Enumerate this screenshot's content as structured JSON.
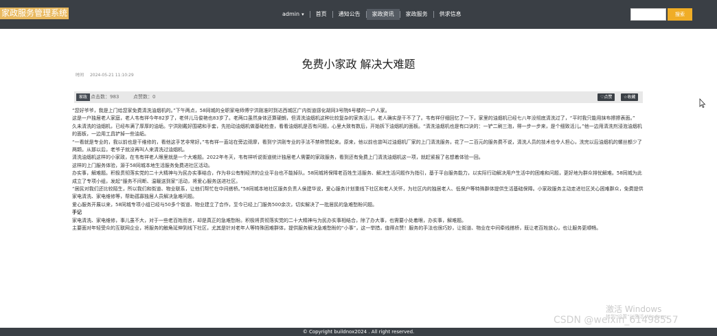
{
  "header": {
    "brand": "家政服务管理系统",
    "user_menu": "admin",
    "nav": [
      "首页",
      "通知公告",
      "家政资讯",
      "家政服务",
      "供求信息"
    ],
    "active_nav": "家政资讯",
    "search_placeholder": "",
    "search_label": "搜索"
  },
  "article": {
    "title": "免费小家政 解决大难题",
    "time_label": "时间",
    "time_value": "2024-05-21 11:10:29",
    "tag": "家政",
    "clicks": "点击数：983",
    "likes": "点赞数：0",
    "like_button": "♡点赞",
    "favorite_button": "☆收藏",
    "paragraphs": [
      "“您好爷爷，我是上门给您家免费清洗油烟机的。”下午两点，58同城的全职家电师傅宁洪刚准时到达西城区广内街道感化胡同3号院6号楼的一户人家。",
      "这是一户独居老人家庭，老人韦有祥今年82岁了，老伴儿马俊艳也83岁了。老两口虽然身体还算硬朗，但清洗油烟机这种比较复杂的家务活儿，老人确实是干不了了。韦有祥仔细回忆了一下，家里的油烟机已经七八年没彻底清洗过了，“平时我只能用抹布擦擦表面。”",
      "久未清洗的油烟机，已经布满了厚厚的油垢。宁洪刚戴好围裙和手套，先拍动油烟机做基础检查，看看油烟机是否有问题，心里大致有数后，开始拆下油烟机的面板。“清洗油烟机也是有口诀的：一铲二刷三泡，得一步一步来，是个细致活儿。”他一边用清洗剂浸泡油烟机的面板，一边用工具铲掉一些油垢。",
      "“一看就是专业的，我以前也是干维修的，看他这手艺非常好。”韦有祥一直站在旁边观摩，看到宁洪刚专业的手法不禁称赞起来。原来，他以前也曾叫过油烟机厂家的上门清洗服务，花了一二百元的服务费不说，清洗人员的技术也令人担心，洗完以后油烟机的螺丝都少了两颗。从那以后，老爷子就没再叫人来清洗过油烟机。",
      "清洗油烟机这样的小家政，在韦有祥老人眼里就是一个大难题。2022年冬天，韦有祥听说街道统计独居老人需要的家政服务，看到还有免费上门清洗油烟机这一项，就赶紧报了名想着体验一回。",
      "这样的上门服务体验，源于58同城本地生活服务免费进社区活动。",
      "办实事，解难题。积极贯彻落实党的二十大精神与为民办实事结合，作为非公有制经济的企业平台也不能掉队。58同城将保障老百姓生活服务、解决生活问题作为指引，基于平台服务能力，以实际行动解决用户生活中的困难和问题，更好地为群众排忧解难。58同城为此成立了专项小组，发起“服务不间断、温暖送到家”活动，将爱心服务送进社区。",
      "“居民对我们还比较陌生，所以我们和街道、物业联系，让他们帮忙在中间搭桥。”58同城本地社区服务负责人侯建华说，爱心服务计划重线下社区和老人关怀，为社区内的独居老人、低保户等特殊群体提供生活基础保障。小家政服务主动走进社区关心困难群众，免费提供家电清洗、家电维修等，帮助孤寡独居人员解决急难问题。",
      "爱心服务开展以来，58同城专项小组已经与50多个街道、物业建立了合作，至今已经上门服务500余次，切实解决了一批居民的急难愁盼问题。",
      "手记",
      "家电清洗、家电维修，事儿虽不大，对于一些老百姓而言，却是真正的急难愁盼。积极将贯彻落实党的二十大精神与为民办实事相结合，除了办大事，也需要小处着眼，办实事，解难题。",
      "主要面对年轻受众的互联网企业，将服务的触角延伸到线下社区，尤其是针对老年人等特殊困难群体，提供服务解决急难愁盼的“小事”，这一举措，值得点赞！服务的手法也很巧妙，让街道、物业在中间牵线搭桥，既让老百姓放心，也让服务更顺畅。"
    ]
  },
  "watermark": {
    "activate_title": "激活 Windows",
    "activate_sub": "转到\"设置\"以激活 Windows。",
    "csdn": "CSDN @weixin_61498557"
  },
  "footer": {
    "copyright": "© Copyright buildnox2024 . All right reserved."
  }
}
